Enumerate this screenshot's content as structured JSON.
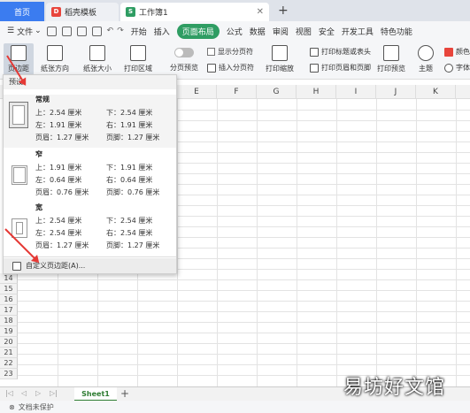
{
  "tabs": {
    "home": "首页",
    "template": "稻壳模板",
    "workbook": "工作簿1",
    "wb_badge": "S",
    "tpl_badge": "D"
  },
  "menu": {
    "file": "文件",
    "start": "开始",
    "insert": "插入",
    "page_layout": "页面布局",
    "formula": "公式",
    "data": "数据",
    "review": "审阅",
    "view": "视图",
    "security": "安全",
    "dev_tools": "开发工具",
    "special": "特色功能"
  },
  "ribbon": {
    "margin": "页边距",
    "orientation": "纸张方向",
    "size": "纸张大小",
    "print_area": "打印区域",
    "page_preview": "分页预览",
    "show_page_break": "显示分页符",
    "insert_page_break": "插入分页符",
    "print_zoom": "打印缩放",
    "print_titles": "打印标题或表头",
    "print_header_footer": "打印页眉和页脚",
    "print_preview": "打印预览",
    "theme": "主题",
    "color": "颜色",
    "font": "字体"
  },
  "columns": [
    "E",
    "F",
    "G",
    "H",
    "I",
    "J",
    "K"
  ],
  "rows": [
    "14",
    "15",
    "16",
    "17",
    "18",
    "19",
    "20",
    "21",
    "22",
    "23"
  ],
  "dropdown": {
    "header": "预设",
    "presets": [
      {
        "name": "常规",
        "top": "上：2.54 厘米",
        "bottom": "下：2.54 厘米",
        "left": "左：1.91 厘米",
        "right": "右：1.91 厘米",
        "header": "页眉：1.27 厘米",
        "footer": "页脚：1.27 厘米"
      },
      {
        "name": "窄",
        "top": "上：1.91 厘米",
        "bottom": "下：1.91 厘米",
        "left": "左：0.64 厘米",
        "right": "右：0.64 厘米",
        "header": "页眉：0.76 厘米",
        "footer": "页脚：0.76 厘米"
      },
      {
        "name": "宽",
        "top": "上：2.54 厘米",
        "bottom": "下：2.54 厘米",
        "left": "左：2.54 厘米",
        "right": "右：2.54 厘米",
        "header": "页眉：1.27 厘米",
        "footer": "页脚：1.27 厘米"
      }
    ],
    "custom": "自定义页边距(A)..."
  },
  "sheet": {
    "name": "Sheet1"
  },
  "status": {
    "protect": "文档未保护"
  },
  "watermark": "易坊好文馆",
  "colors": {
    "accent": "#2f9d63",
    "tab_active": "#3b7cf0",
    "arrow": "#e53935"
  }
}
